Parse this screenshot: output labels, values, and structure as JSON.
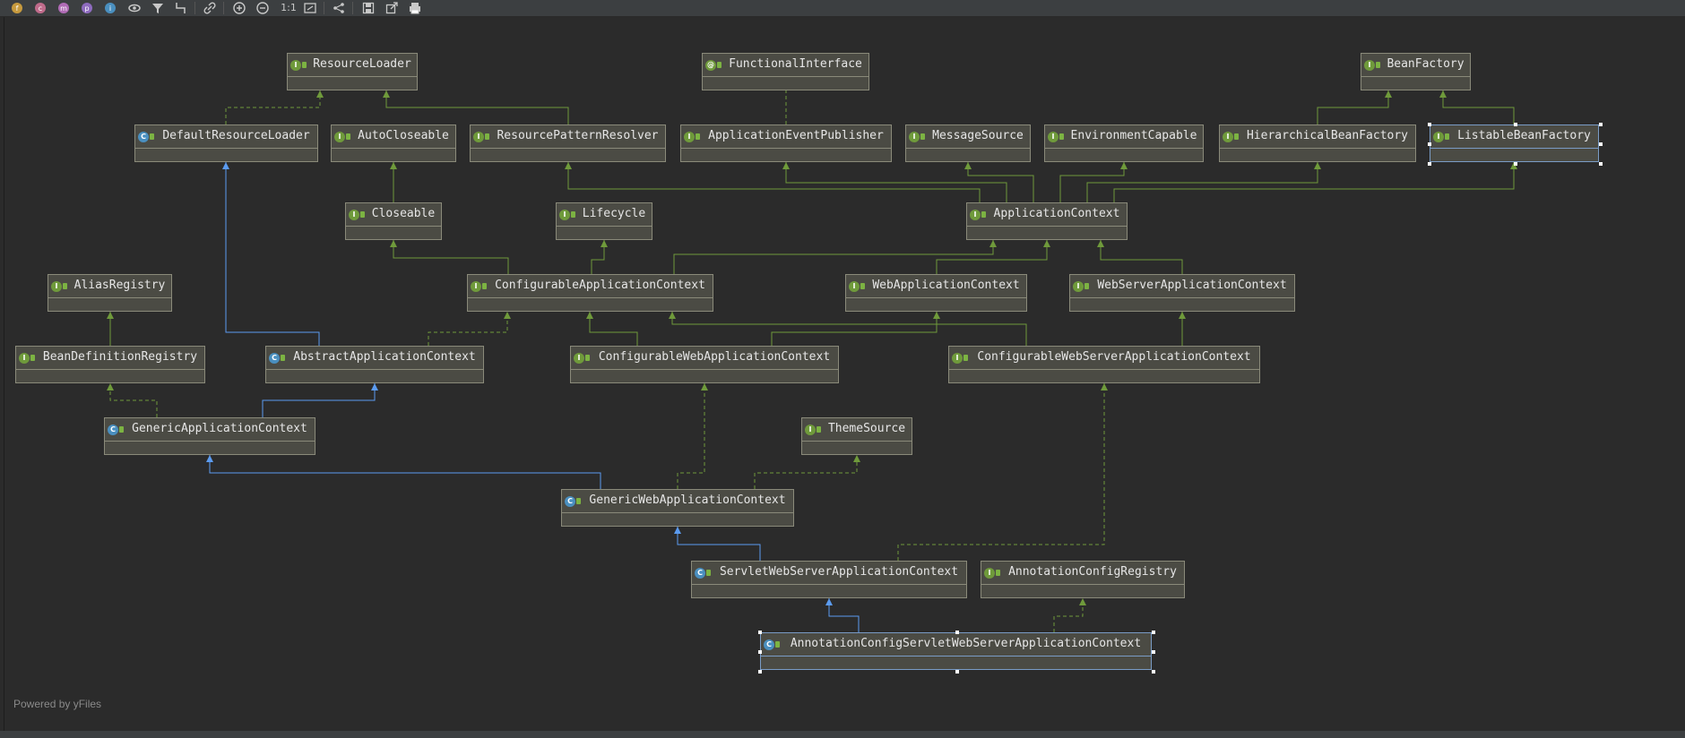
{
  "toolbar": {
    "buttons": [
      {
        "id": "f",
        "icon": "fields-icon",
        "glyph": "f",
        "color": "#c79a3e"
      },
      {
        "id": "c",
        "icon": "constructors-icon",
        "glyph": "c",
        "color": "#c06b8b"
      },
      {
        "id": "m",
        "icon": "methods-icon",
        "glyph": "m",
        "color": "#b06bb5"
      },
      {
        "id": "p",
        "icon": "properties-icon",
        "glyph": "p",
        "color": "#8e6bbf"
      },
      {
        "id": "i",
        "icon": "inner-classes-icon",
        "glyph": "i",
        "color": "#4a8fbf"
      }
    ],
    "scale_label": "1:1"
  },
  "diagram": {
    "nodes": [
      {
        "id": "ResourceLoader",
        "label": "ResourceLoader",
        "kind": "interface"
      },
      {
        "id": "FunctionalInterface",
        "label": "FunctionalInterface",
        "kind": "annotation"
      },
      {
        "id": "BeanFactory",
        "label": "BeanFactory",
        "kind": "interface"
      },
      {
        "id": "DefaultResourceLoader",
        "label": "DefaultResourceLoader",
        "kind": "class"
      },
      {
        "id": "AutoCloseable",
        "label": "AutoCloseable",
        "kind": "interface"
      },
      {
        "id": "ResourcePatternResolver",
        "label": "ResourcePatternResolver",
        "kind": "interface"
      },
      {
        "id": "ApplicationEventPublisher",
        "label": "ApplicationEventPublisher",
        "kind": "interface"
      },
      {
        "id": "MessageSource",
        "label": "MessageSource",
        "kind": "interface"
      },
      {
        "id": "EnvironmentCapable",
        "label": "EnvironmentCapable",
        "kind": "interface"
      },
      {
        "id": "HierarchicalBeanFactory",
        "label": "HierarchicalBeanFactory",
        "kind": "interface"
      },
      {
        "id": "ListableBeanFactory",
        "label": "ListableBeanFactory",
        "kind": "interface",
        "selected": true
      },
      {
        "id": "Closeable",
        "label": "Closeable",
        "kind": "interface"
      },
      {
        "id": "Lifecycle",
        "label": "Lifecycle",
        "kind": "interface"
      },
      {
        "id": "ApplicationContext",
        "label": "ApplicationContext",
        "kind": "interface"
      },
      {
        "id": "AliasRegistry",
        "label": "AliasRegistry",
        "kind": "interface"
      },
      {
        "id": "ConfigurableApplicationContext",
        "label": "ConfigurableApplicationContext",
        "kind": "interface"
      },
      {
        "id": "WebApplicationContext",
        "label": "WebApplicationContext",
        "kind": "interface"
      },
      {
        "id": "WebServerApplicationContext",
        "label": "WebServerApplicationContext",
        "kind": "interface"
      },
      {
        "id": "BeanDefinitionRegistry",
        "label": "BeanDefinitionRegistry",
        "kind": "interface"
      },
      {
        "id": "AbstractApplicationContext",
        "label": "AbstractApplicationContext",
        "kind": "abstract"
      },
      {
        "id": "ConfigurableWebApplicationContext",
        "label": "ConfigurableWebApplicationContext",
        "kind": "interface"
      },
      {
        "id": "ConfigurableWebServerApplicationContext",
        "label": "ConfigurableWebServerApplicationContext",
        "kind": "interface"
      },
      {
        "id": "GenericApplicationContext",
        "label": "GenericApplicationContext",
        "kind": "class"
      },
      {
        "id": "ThemeSource",
        "label": "ThemeSource",
        "kind": "interface"
      },
      {
        "id": "GenericWebApplicationContext",
        "label": "GenericWebApplicationContext",
        "kind": "class"
      },
      {
        "id": "ServletWebServerApplicationContext",
        "label": "ServletWebServerApplicationContext",
        "kind": "class"
      },
      {
        "id": "AnnotationConfigRegistry",
        "label": "AnnotationConfigRegistry",
        "kind": "interface"
      },
      {
        "id": "AnnotationConfigServletWebServerApplicationContext",
        "label": "AnnotationConfigServletWebServerApplicationContext",
        "kind": "class",
        "selected": true
      }
    ],
    "edges": [
      {
        "from": "DefaultResourceLoader",
        "to": "ResourceLoader",
        "type": "implements"
      },
      {
        "from": "ResourcePatternResolver",
        "to": "ResourceLoader",
        "type": "extends"
      },
      {
        "from": "HierarchicalBeanFactory",
        "to": "BeanFactory",
        "type": "extends"
      },
      {
        "from": "ListableBeanFactory",
        "to": "BeanFactory",
        "type": "extends"
      },
      {
        "from": "ApplicationEventPublisher",
        "to": "FunctionalInterface",
        "type": "annotated"
      },
      {
        "from": "Closeable",
        "to": "AutoCloseable",
        "type": "extends"
      },
      {
        "from": "ApplicationContext",
        "to": "ResourcePatternResolver",
        "type": "extends"
      },
      {
        "from": "ApplicationContext",
        "to": "ApplicationEventPublisher",
        "type": "extends"
      },
      {
        "from": "ApplicationContext",
        "to": "MessageSource",
        "type": "extends"
      },
      {
        "from": "ApplicationContext",
        "to": "EnvironmentCapable",
        "type": "extends"
      },
      {
        "from": "ApplicationContext",
        "to": "HierarchicalBeanFactory",
        "type": "extends"
      },
      {
        "from": "ApplicationContext",
        "to": "ListableBeanFactory",
        "type": "extends"
      },
      {
        "from": "ConfigurableApplicationContext",
        "to": "Closeable",
        "type": "extends"
      },
      {
        "from": "ConfigurableApplicationContext",
        "to": "Lifecycle",
        "type": "extends"
      },
      {
        "from": "ConfigurableApplicationContext",
        "to": "ApplicationContext",
        "type": "extends"
      },
      {
        "from": "WebApplicationContext",
        "to": "ApplicationContext",
        "type": "extends"
      },
      {
        "from": "WebServerApplicationContext",
        "to": "ApplicationContext",
        "type": "extends"
      },
      {
        "from": "BeanDefinitionRegistry",
        "to": "AliasRegistry",
        "type": "extends"
      },
      {
        "from": "AbstractApplicationContext",
        "to": "DefaultResourceLoader",
        "type": "class-extends"
      },
      {
        "from": "AbstractApplicationContext",
        "to": "ConfigurableApplicationContext",
        "type": "implements"
      },
      {
        "from": "ConfigurableWebApplicationContext",
        "to": "ConfigurableApplicationContext",
        "type": "extends"
      },
      {
        "from": "ConfigurableWebApplicationContext",
        "to": "WebApplicationContext",
        "type": "extends"
      },
      {
        "from": "ConfigurableWebServerApplicationContext",
        "to": "ConfigurableApplicationContext",
        "type": "extends"
      },
      {
        "from": "ConfigurableWebServerApplicationContext",
        "to": "WebServerApplicationContext",
        "type": "extends"
      },
      {
        "from": "GenericApplicationContext",
        "to": "BeanDefinitionRegistry",
        "type": "implements"
      },
      {
        "from": "GenericApplicationContext",
        "to": "AbstractApplicationContext",
        "type": "class-extends"
      },
      {
        "from": "GenericWebApplicationContext",
        "to": "GenericApplicationContext",
        "type": "class-extends"
      },
      {
        "from": "GenericWebApplicationContext",
        "to": "ConfigurableWebApplicationContext",
        "type": "implements"
      },
      {
        "from": "GenericWebApplicationContext",
        "to": "ThemeSource",
        "type": "implements"
      },
      {
        "from": "ServletWebServerApplicationContext",
        "to": "GenericWebApplicationContext",
        "type": "class-extends"
      },
      {
        "from": "ServletWebServerApplicationContext",
        "to": "ConfigurableWebServerApplicationContext",
        "type": "implements"
      },
      {
        "from": "AnnotationConfigServletWebServerApplicationContext",
        "to": "ServletWebServerApplicationContext",
        "type": "class-extends"
      },
      {
        "from": "AnnotationConfigServletWebServerApplicationContext",
        "to": "AnnotationConfigRegistry",
        "type": "implements"
      }
    ],
    "colors": {
      "interface_edge": "#6f9a3b",
      "class_edge": "#5b9bf0",
      "node_fill": "#4b4b44",
      "node_border": "#8a8a7a"
    }
  },
  "footer": {
    "powered_by": "Powered by yFiles"
  }
}
